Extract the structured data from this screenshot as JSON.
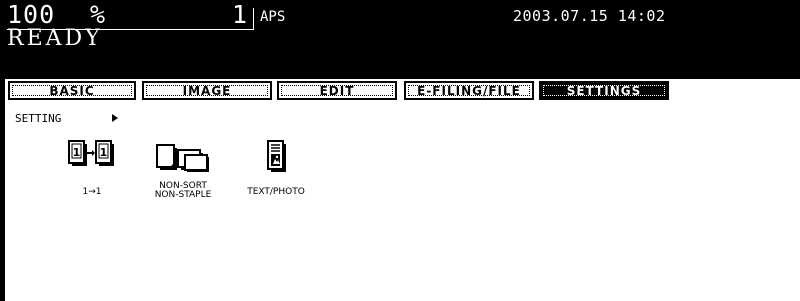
{
  "header": {
    "ratio": "100",
    "ratio_unit": "%",
    "copies": "1",
    "paper_mode": "APS",
    "datetime": "2003.07.15 14:02",
    "status": "READY"
  },
  "tabs": [
    {
      "label": "BASIC",
      "active": false
    },
    {
      "label": "IMAGE",
      "active": false
    },
    {
      "label": "EDIT",
      "active": false
    },
    {
      "label": "E-FILING/FILE",
      "active": false
    },
    {
      "label": "SETTINGS",
      "active": true
    }
  ],
  "setting": {
    "label": "SETTING"
  },
  "settings_icons": [
    {
      "icon": "one-sided-to-one-sided-icon",
      "label": "1→1"
    },
    {
      "icon": "non-sort-non-staple-icon",
      "label_line1": "NON-SORT",
      "label_line2": "NON-STAPLE"
    },
    {
      "icon": "text-photo-icon",
      "label": "TEXT/PHOTO"
    }
  ]
}
